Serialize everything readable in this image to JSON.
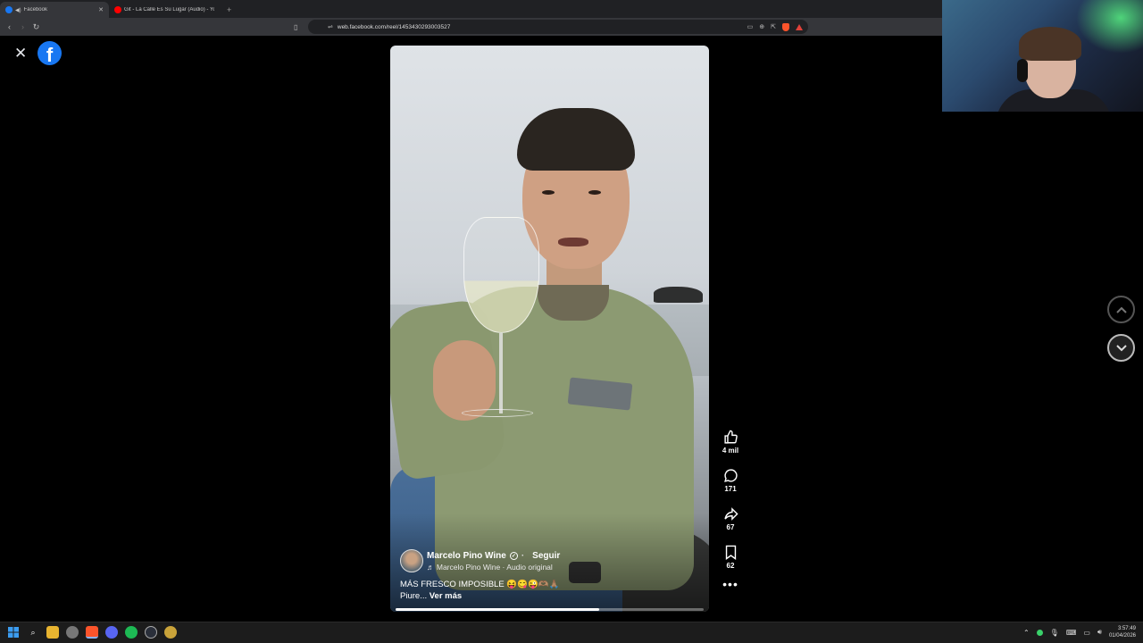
{
  "browser": {
    "tabs": [
      {
        "title": "Facebook",
        "active": true,
        "favicon_color": "#1877f2"
      },
      {
        "title": "Git - La Calle Es Su Lugar (Audio) - Yo",
        "active": false,
        "favicon_color": "#ff0000"
      }
    ],
    "new_tab_symbol": "+",
    "close_tab_symbol": "✕",
    "url": "web.facebook.com/reel/1453430293003527",
    "nav": {
      "back": "‹",
      "forward": "›",
      "reload": "↻"
    },
    "icons": [
      "bookmark-icon",
      "site-info-icon",
      "cast-icon",
      "zoom-icon",
      "share-icon",
      "brave-shield-icon",
      "brave-rewards-icon"
    ]
  },
  "page": {
    "close_symbol": "✕",
    "logo_letter": "f",
    "brand_color": "#1877f2"
  },
  "reel": {
    "author_name": "Marcelo Pino Wine",
    "follow_label": "Seguir",
    "audio_label": "♬ Marcelo Pino Wine · Audio original",
    "caption_line1": "MÁS FRESCO IMPOSIBLE 😝😋😜🫶🏽🙏🏽",
    "caption_line2": "Piure...",
    "see_more": "Ver más",
    "progress_fraction": 0.66,
    "actions": {
      "likes": "4 mil",
      "comments": "171",
      "shares": "67",
      "saves": "62"
    },
    "more_symbol": "•••"
  },
  "taskbar": {
    "time": "3:57:49",
    "date": "01/04/2026"
  }
}
